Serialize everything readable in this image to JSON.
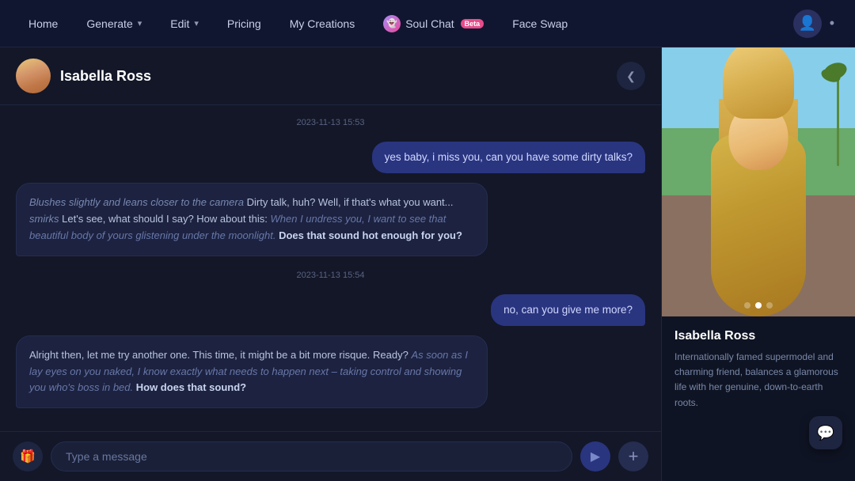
{
  "nav": {
    "home": "Home",
    "generate": "Generate",
    "edit": "Edit",
    "pricing": "Pricing",
    "my_creations": "My Creations",
    "soul_chat": "Soul Chat",
    "soul_chat_badge": "Beta",
    "face_swap": "Face Swap"
  },
  "chat": {
    "char_name": "Isabella Ross",
    "collapse_icon": "❮",
    "timestamp1": "2023-11-13 15:53",
    "timestamp2": "2023-11-13 15:54",
    "msg_user1": "yes baby, i miss you, can you have some dirty talks?",
    "msg_ai1_italic1": "Blushes slightly and leans closer to the camera",
    "msg_ai1_normal1": " Dirty talk, huh? Well, if that's what you want...",
    "msg_ai1_italic2": " smirks",
    "msg_ai1_normal2": " Let's see, what should I say? How about this: ",
    "msg_ai1_italic3": "When I undress you, I want to see that beautiful body of yours glistening under the moonlight.",
    "msg_ai1_bold": " Does that sound hot enough for you?",
    "msg_user2": "no, can you give me more?",
    "msg_ai2_normal1": "Alright then, let me try another one. This time, it might be a bit more risque. Ready? ",
    "msg_ai2_italic": "As soon as I lay eyes on you naked, I know exactly what needs to happen next – taking control and showing you who's boss in bed.",
    "msg_ai2_bold": " How does that sound?",
    "input_placeholder": "Type a message"
  },
  "sidebar": {
    "char_name": "Isabella Ross",
    "char_desc": "Internationally famed supermodel and charming friend, balances a glamorous life with her genuine, down-to-earth roots."
  },
  "icons": {
    "collapse": "❮",
    "gift": "🎁",
    "send": "▶",
    "add": "+",
    "chat_bubble": "💬",
    "user": "👤"
  }
}
